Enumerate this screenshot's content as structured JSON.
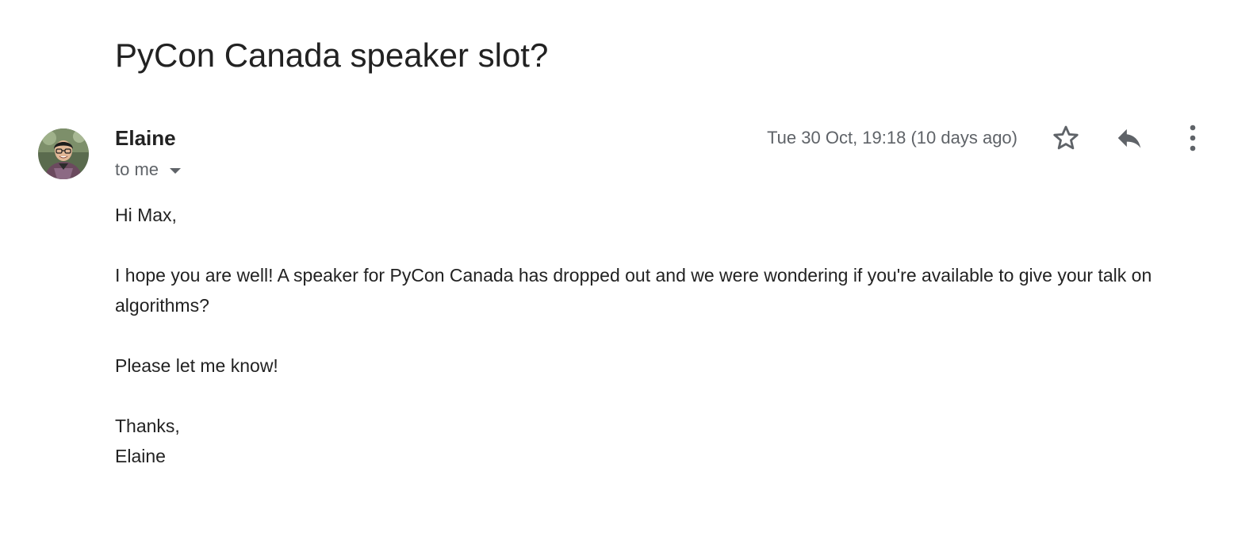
{
  "email": {
    "subject": "PyCon Canada speaker slot?",
    "sender": {
      "name": "Elaine",
      "avatar_icon": "person-photo-avatar"
    },
    "recipient_label": "to me",
    "timestamp": "Tue 30 Oct, 19:18 (10 days ago)",
    "actions": {
      "star_icon": "star-outline-icon",
      "reply_icon": "reply-arrow-icon",
      "more_icon": "vertical-dots-icon"
    },
    "body": {
      "greeting": "Hi Max,",
      "paragraph": "I hope you are well! A speaker for PyCon Canada has dropped out and we were wondering if you're available to give your talk on algorithms?",
      "request": "Please let me know!",
      "closing": "Thanks,",
      "signature": "Elaine"
    }
  },
  "colors": {
    "text": "#222222",
    "muted": "#5f6368",
    "icon": "#5f6368"
  }
}
